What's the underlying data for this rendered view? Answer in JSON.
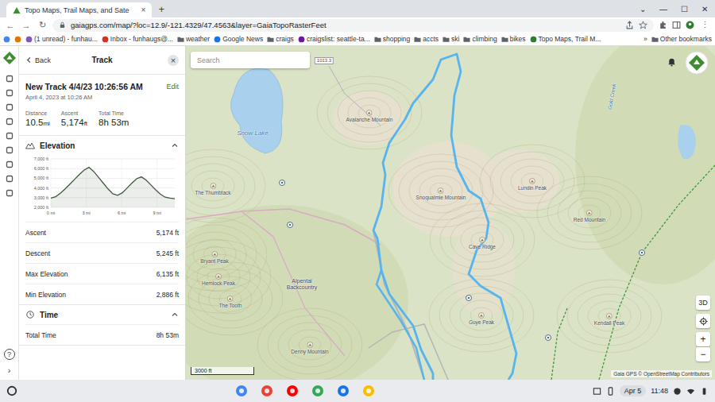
{
  "browser": {
    "tabs": [
      {
        "label": "Topo Maps, Trail Maps, and Sate",
        "selected": true
      }
    ],
    "close_tab": "×",
    "new_tab": "+",
    "window_controls": [
      "⌄",
      "—",
      "☐",
      "✕"
    ],
    "nav": [
      "←",
      "→",
      "↻"
    ],
    "url": "gaiagps.com/map/?loc=12.9/-121.4329/47.4563&layer=GaiaTopoRasterFeet",
    "menu": "⋮",
    "bookmarks": [
      {
        "kind": "icon",
        "label": "",
        "color": "#4285f4"
      },
      {
        "kind": "icon",
        "label": "",
        "color": "#e37400"
      },
      {
        "kind": "site",
        "label": "(1 unread) - funhau...",
        "color": "#7e57c2"
      },
      {
        "kind": "site",
        "label": "Inbox - funhaugs@...",
        "color": "#d93025"
      },
      {
        "kind": "folder",
        "label": "weather",
        "color": "#5f6368"
      },
      {
        "kind": "site",
        "label": "Google News",
        "color": "#1a73e8"
      },
      {
        "kind": "folder",
        "label": "craigs",
        "color": "#5f6368"
      },
      {
        "kind": "site",
        "label": "craigslist: seattle-ta...",
        "color": "#6a1b9a"
      },
      {
        "kind": "folder",
        "label": "shopping",
        "color": "#5f6368"
      },
      {
        "kind": "folder",
        "label": "accts",
        "color": "#5f6368"
      },
      {
        "kind": "folder",
        "label": "ski",
        "color": "#5f6368"
      },
      {
        "kind": "folder",
        "label": "climbing",
        "color": "#5f6368"
      },
      {
        "kind": "folder",
        "label": "bikes",
        "color": "#5f6368"
      },
      {
        "kind": "site",
        "label": "Topo Maps, Trail M...",
        "color": "#2e7d32"
      }
    ],
    "more_bookmarks": "»",
    "other_bookmarks": "Other bookmarks"
  },
  "rail": {
    "help": "?",
    "expand": "›"
  },
  "panel": {
    "back": "Back",
    "title": "Track",
    "close": "×",
    "track_name": "New Track 4/4/23 10:26:56 AM",
    "edit": "Edit",
    "date": "April 4, 2023 at 10:26 AM",
    "stats": [
      {
        "label": "Distance",
        "value": "10.5",
        "unit": "mi"
      },
      {
        "label": "Ascent",
        "value": "5,174",
        "unit": "ft"
      },
      {
        "label": "Total Time",
        "value": "8h 53m",
        "unit": ""
      }
    ],
    "chart": {
      "y_ticks": [
        {
          "label": "7,000 ft",
          "value": 7000
        },
        {
          "label": "6,000 ft",
          "value": 6000
        },
        {
          "label": "5,000 ft",
          "value": 5000
        },
        {
          "label": "4,000 ft",
          "value": 4000
        },
        {
          "label": "3,000 ft",
          "value": 3000
        },
        {
          "label": "2,000 ft",
          "value": 2000
        }
      ],
      "x_ticks": [
        {
          "label": "0 mi",
          "value": 0
        },
        {
          "label": "3 mi",
          "value": 3
        },
        {
          "label": "6 mi",
          "value": 6
        },
        {
          "label": "9 mi",
          "value": 9
        }
      ],
      "x_max": 10.5,
      "series": [
        {
          "name": "Elevation",
          "color": "#3d5a3a",
          "values": [
            2950,
            3100,
            3450,
            3900,
            4400,
            4900,
            5400,
            5850,
            6135,
            5700,
            5100,
            4500,
            3900,
            3400,
            3250,
            3500,
            4000,
            4500,
            4950,
            5150,
            4800,
            4300,
            3800,
            3350,
            3050,
            2950,
            2886
          ]
        }
      ]
    },
    "sections": [
      {
        "kind": "elevation",
        "title": "Elevation",
        "expanded": true,
        "rows": [
          {
            "label": "Ascent",
            "value": "5,174 ft"
          },
          {
            "label": "Descent",
            "value": "5,245 ft"
          },
          {
            "label": "Max Elevation",
            "value": "6,135 ft"
          },
          {
            "label": "Min Elevation",
            "value": "2,886 ft"
          }
        ]
      },
      {
        "kind": "time",
        "title": "Time",
        "expanded": true,
        "rows": [
          {
            "label": "Total Time",
            "value": "8h 53m"
          }
        ]
      }
    ]
  },
  "map": {
    "search_placeholder": "Search",
    "labels": [
      {
        "text": "Snow Lake",
        "kind": "water"
      },
      {
        "text": "Avalanche Mountain",
        "kind": "peak"
      },
      {
        "text": "The Thumbtack",
        "kind": "peak"
      },
      {
        "text": "Snoqualmie Mountain",
        "kind": "peak"
      },
      {
        "text": "Lundin Peak",
        "kind": "peak"
      },
      {
        "text": "Red Mountain",
        "kind": "peak"
      },
      {
        "text": "Cave Ridge",
        "kind": "peak"
      },
      {
        "text": "Guye Peak",
        "kind": "peak"
      },
      {
        "text": "Alpental Backcountry",
        "kind": "place"
      },
      {
        "text": "Denny Mountain",
        "kind": "peak"
      },
      {
        "text": "Bryant Peak",
        "kind": "peak"
      },
      {
        "text": "Hemlock Peak",
        "kind": "peak"
      },
      {
        "text": "The Tooth",
        "kind": "peak"
      },
      {
        "text": "Kendall Peak",
        "kind": "peak"
      },
      {
        "text": "Gold Creek",
        "kind": "creek"
      },
      {
        "text": "1013.3",
        "kind": "road"
      }
    ],
    "controls": [
      "3D",
      "+",
      "−"
    ],
    "scale": "3000 ft",
    "attribution": "Gaia GPS © OpenStreetMap Contributors"
  },
  "shelf": {
    "apps": [
      {
        "color": "#4285f4"
      },
      {
        "color": "#ea4335"
      },
      {
        "color": "#ff0000"
      },
      {
        "color": "#34a853"
      },
      {
        "color": "#1a73e8"
      },
      {
        "color": "#fbbc04"
      }
    ],
    "date": "Apr 5",
    "time": "11:48"
  }
}
